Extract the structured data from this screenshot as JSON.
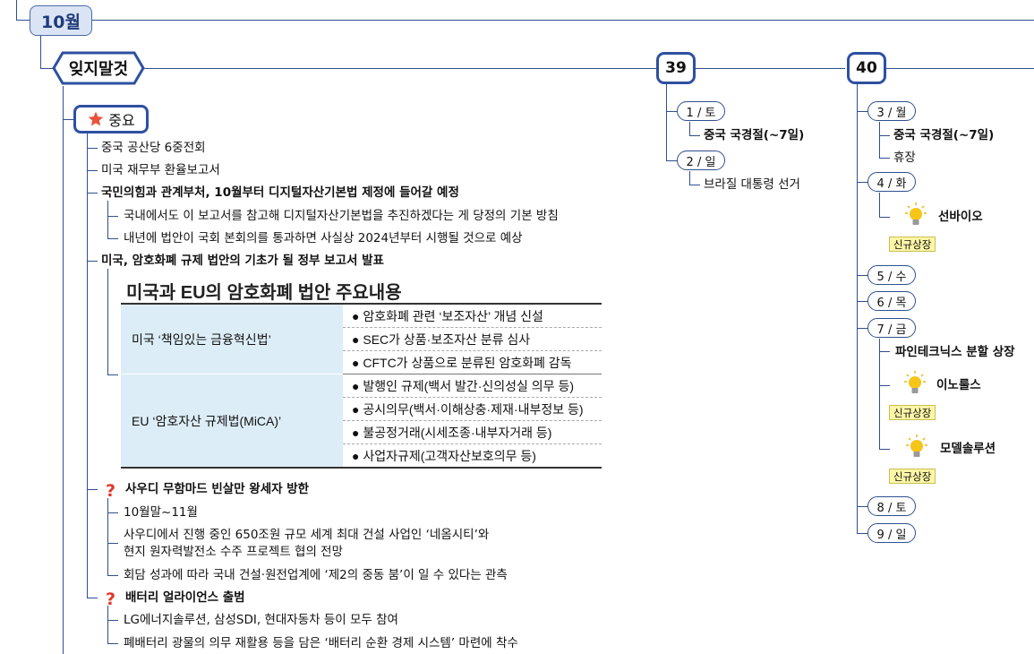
{
  "month": "10월",
  "topic": "잊지말것",
  "important": {
    "label": "중요",
    "items": [
      {
        "text": "중국 공산당 6중전회"
      },
      {
        "text": "미국 재무부 환율보고서"
      },
      {
        "text": "국민의힘과 관계부처, 10월부터 디지털자산기본법 제정에 들어갈 예정"
      },
      {
        "text": "국내에서도 이 보고서를 참고해 디지털자산기본법을 추진하겠다는 게 당정의 기본 방침"
      },
      {
        "text": "내년에 법안이 국회 본회의를 통과하면 사실상 2024년부터 시행될 것으로 예상"
      },
      {
        "text": "미국, 암호화폐 규제 법안의 기초가 될 정부 보고서 발표"
      }
    ],
    "embedded_table": {
      "title": "미국과 EU의 암호화폐 법안 주요내용",
      "groups": [
        {
          "name": "미국 ‘책임있는 금융혁신법’",
          "items": [
            "암호화폐 관련 ‘보조자산’ 개념 신설",
            "SEC가 상품·보조자산 분류 심사",
            "CFTC가 상품으로 분류된 암호화폐 감독"
          ]
        },
        {
          "name": "EU ‘암호자산 규제법(MiCA)’",
          "items": [
            "발행인 규제(백서 발간·신의성실 의무 등)",
            "공시의무(백서·이해상충·제재·내부정보 등)",
            "불공정거래(시세조종·내부자거래 등)",
            "사업자규제(고객자산보호의무 등)"
          ]
        }
      ]
    },
    "saudi": {
      "title": "사우디 무함마드 빈살만 왕세자 방한",
      "items": [
        "10월말~11월",
        "사우디에서 진행 중인 650조원 규모 세계 최대 건설 사업인 ‘네옴시티’와",
        "현지 원자력발전소 수주 프로젝트 협의 전망",
        "회담 성과에 따라 국내 건설·원전업계에 ‘제2의 중동 붐’이 일 수 있다는 관측"
      ]
    },
    "battery": {
      "title": "배터리 얼라이언스 출범",
      "items": [
        "LG에너지솔루션, 삼성SDI, 현대자동차 등이 모두 참여",
        "폐배터리 광물의 의무 재활용 등을 담은 ‘배터리 순환 경제 시스템’ 마련에 착수"
      ]
    }
  },
  "week39": {
    "number": "39",
    "days": [
      {
        "label": "1 / 토",
        "notes": [
          "중국 국경절(~7일)"
        ]
      },
      {
        "label": "2 / 일",
        "notes": [
          "브라질 대통령 선거"
        ]
      }
    ]
  },
  "week40": {
    "number": "40",
    "days": [
      {
        "label": "3 / 월",
        "notes": [
          "중국 국경절(~7일)",
          "휴장"
        ]
      },
      {
        "label": "4 / 화",
        "ipos": [
          {
            "name": "선바이오",
            "badge": "신규상장"
          }
        ]
      },
      {
        "label": "5 / 수"
      },
      {
        "label": "6 / 목"
      },
      {
        "label": "7 / 금",
        "notes": [
          "파인테크닉스 분할 상장"
        ],
        "ipos": [
          {
            "name": "이노룰스",
            "badge": "신규상장"
          },
          {
            "name": "모델솔루션",
            "badge": "신규상장"
          }
        ]
      },
      {
        "label": "8 / 토"
      },
      {
        "label": "9 / 일"
      }
    ]
  },
  "colors": {
    "connector": "#2f4f8f",
    "box_border": "#2d50a0",
    "month_fill": "#dbe4f5",
    "badge_fill": "#fdf6a6",
    "table_cell": "#dcedf7",
    "star": "#e8553c",
    "question": "#e0382b",
    "bulb": "#f5c518"
  },
  "icons": [
    "star-icon",
    "question-icon",
    "lightbulb-icon"
  ]
}
